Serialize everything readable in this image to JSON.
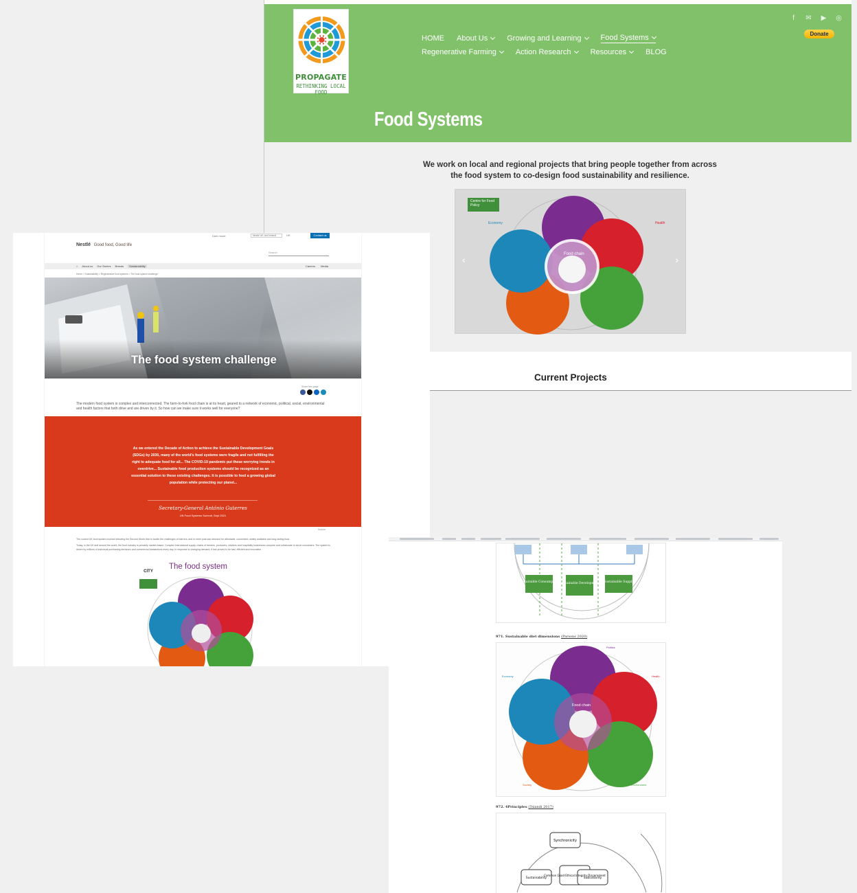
{
  "propagate": {
    "logo": {
      "line1": "PROPAGATE",
      "line2": "RETHINKING LOCAL FOOD"
    },
    "nav_row1": [
      {
        "label": "HOME",
        "dropdown": false,
        "active": false
      },
      {
        "label": "About Us",
        "dropdown": true,
        "active": false
      },
      {
        "label": "Growing and Learning",
        "dropdown": true,
        "active": false
      },
      {
        "label": "Food Systems",
        "dropdown": true,
        "active": true
      }
    ],
    "nav_row2": [
      {
        "label": "Regenerative Farming",
        "dropdown": true
      },
      {
        "label": "Action Research",
        "dropdown": true
      },
      {
        "label": "Resources",
        "dropdown": true
      },
      {
        "label": "BLOG",
        "dropdown": false
      }
    ],
    "social_icons": [
      "facebook-icon",
      "email-icon",
      "youtube-icon",
      "instagram-icon"
    ],
    "donate_label": "Donate",
    "page_title": "Food Systems",
    "intro": "We work on local and regional projects that bring people together from across the food system to co-design food sustainability and resilience.",
    "carousel": {
      "badge": "Centre for Food Policy",
      "label_left": "Economy",
      "label_right": "Health",
      "label_center": "Food chain"
    },
    "section_title": "Current Projects",
    "colors": {
      "header_green": "#80c16a",
      "donate_yellow": "#f5b400"
    }
  },
  "nestle": {
    "top_toggle": "Dark mode",
    "top_select": "Nestlé UK and Ireland",
    "top_lang": "UK",
    "contact_label": "Contact us",
    "brand_mark": "Nestlé",
    "brand_tagline": "Good food, Good life",
    "search_placeholder": "Search",
    "subnav": [
      "About us",
      "Our Stories",
      "Brands",
      "Sustainability"
    ],
    "subnav_right": [
      "Careers",
      "Media"
    ],
    "breadcrumb": "Home  >  Sustainability  >  Regenerative food systems  >  The food system challenge",
    "hero_title": "The food system challenge",
    "share_label": "Share this page",
    "lead": "The modern food system is complex and interconnected. The farm-to-fork food chain is at its heart, geared to a network of economic, political, social, environmental and health factors that both drive and are driven by it. So how can we make sure it works well for everyone?",
    "quote": "As we entered the Decade of Action to achieve the Sustainable Development Goals (SDGs) by 2030, many of the world's food systems were fragile and not fulfilling the right to adequate food for all... The COVID-19 pandemic put these worrying trends in overdrive... Sustainable food production systems should be recognized as an essential solution to these existing challenges. It is possible to feed a growing global population while protecting our planet...",
    "quote_signature": "Secretary-General António Guterres",
    "quote_source": "UN Food Systems Summit, Sept 2021",
    "source_label": "Source",
    "body1": "The current UK food system evolved following the Second World War to tackle the challenges of that era, and to meet post-war demand for affordable, convenient, widely available and long-lasting food.",
    "body2": "Today, in the UK and around the world, the food industry is primarily market-based. Complex international supply chains of farmers, producers, retailers and hospitality businesses compete and collaborate to serve consumers. The system is driven by millions of individual purchasing decisions and commercial transactions every day. In response to changing demand, it has proved to be fast, efficient and innovative.",
    "city_logo": "CITY",
    "diagram_title": "The food system",
    "colors": {
      "quote_red": "#d93a1b",
      "title_purple": "#7b2c86"
    }
  },
  "doc": {
    "fig1_boxes": [
      "Sustainable Consumption",
      "Sustainable Development",
      "Sustainable Supply"
    ],
    "caption2": "971. Sustainable diet dimensions",
    "caption2_ref": "(Parsons 2020)",
    "fig2_labels": {
      "top": "Politics",
      "left": "Economy",
      "right": "Health",
      "bottom_left": "Society",
      "bottom_right": "Environment",
      "center": "Food chain"
    },
    "caption3": "972. 4Principles",
    "caption3_ref": "(Tsiandi 2017)",
    "fig3_nodes": [
      "Synchronicity",
      "Common Good Ethical Integrity Discernment",
      "Sustainability",
      "Subsidiarity"
    ]
  }
}
